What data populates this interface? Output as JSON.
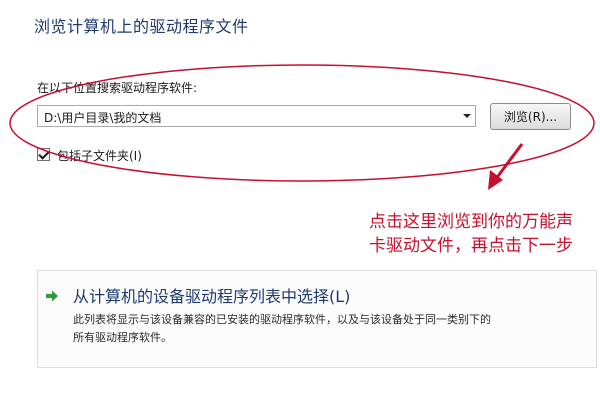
{
  "dialog": {
    "title": "浏览计算机上的驱动程序文件",
    "search_label": "在以下位置搜索驱动程序软件:",
    "path_value": "D:\\用户目录\\我的文档",
    "browse_button_label": "浏览(R)...",
    "include_subfolders_label": "包括子文件夹(I)",
    "include_subfolders_checked": true
  },
  "annotation": {
    "lines": [
      "点击这里浏览到你的万能声",
      "卡驱动文件，再点击下一步"
    ],
    "color": "#c8102e"
  },
  "option": {
    "title": "从计算机的设备驱动程序列表中选择(L)",
    "description_lines": [
      "此列表将显示与该设备兼容的已安装的驱动程序软件，以及与该设备处于同一类别下的",
      "所有驱动程序软件。"
    ],
    "arrow_color": "#2a9d3a"
  },
  "colors": {
    "title_blue": "#1e3a6e",
    "annotation_red": "#c8102e"
  }
}
